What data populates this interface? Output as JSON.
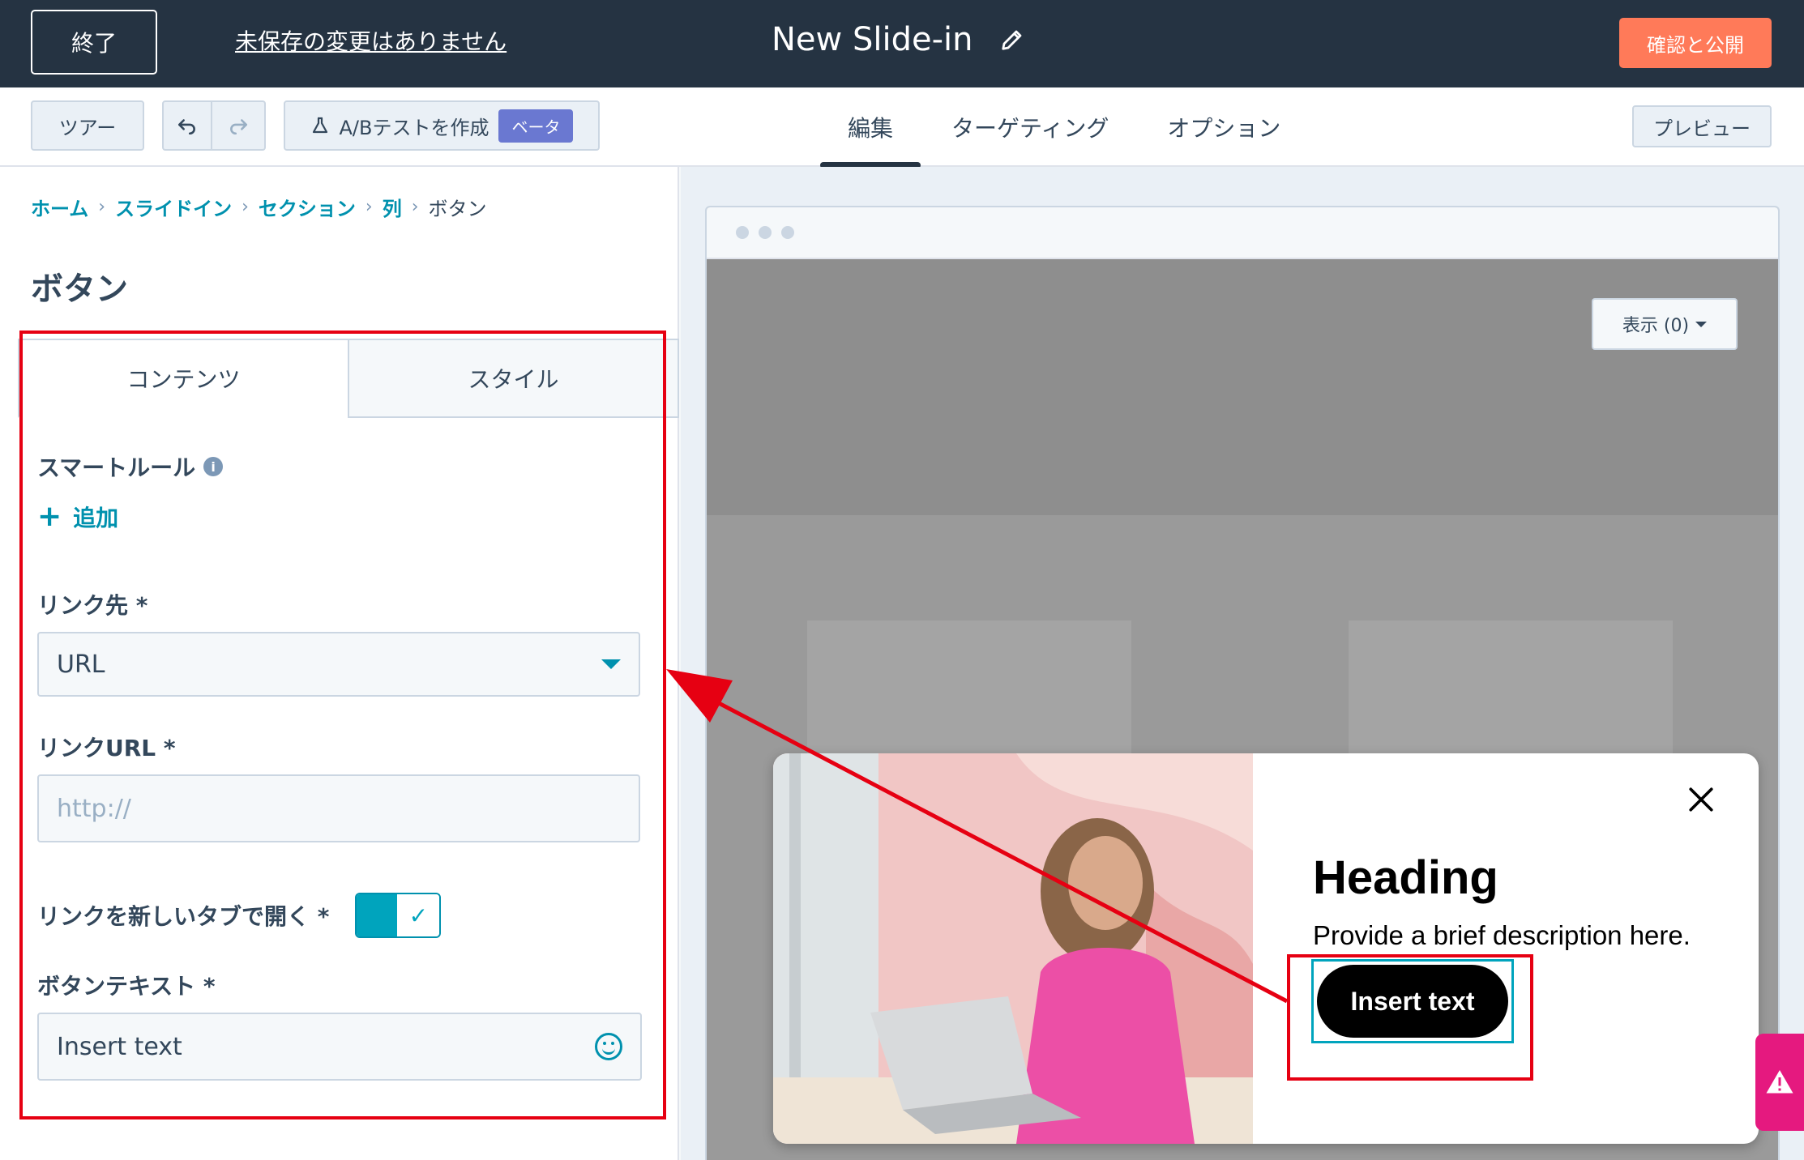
{
  "topbar": {
    "exit_label": "終了",
    "unsaved_label": "未保存の変更はありません",
    "title": "New Slide-in",
    "publish_label": "確認と公開"
  },
  "toolbar": {
    "tour_label": "ツアー",
    "ab_label": "A/Bテストを作成",
    "beta_label": "ベータ",
    "tabs": [
      {
        "label": "編集",
        "active": true
      },
      {
        "label": "ターゲティング",
        "active": false
      },
      {
        "label": "オプション",
        "active": false
      }
    ],
    "preview_label": "プレビュー"
  },
  "left_panel": {
    "breadcrumb": [
      "ホーム",
      "スライドイン",
      "セクション",
      "列",
      "ボタン"
    ],
    "title": "ボタン",
    "tabs": [
      "コンテンツ",
      "スタイル"
    ],
    "smart_rules_label": "スマートルール",
    "add_label": "追加",
    "link_target_label": "リンク先 *",
    "link_target_value": "URL",
    "link_url_label": "リンクURL *",
    "link_url_placeholder": "http://",
    "new_tab_label": "リンクを新しいタブで開く *",
    "new_tab_checked": true,
    "button_text_label": "ボタンテキスト *",
    "button_text_value": "Insert text"
  },
  "canvas": {
    "view_label": "表示 (0)",
    "slidein": {
      "heading": "Heading",
      "description": "Provide a brief description here.",
      "button_text": "Insert text"
    }
  },
  "colors": {
    "topbar_bg": "#253342",
    "accent": "#0091ae",
    "publish": "#ff7a59",
    "annotation": "#e60012",
    "beta": "#6a78d1"
  }
}
